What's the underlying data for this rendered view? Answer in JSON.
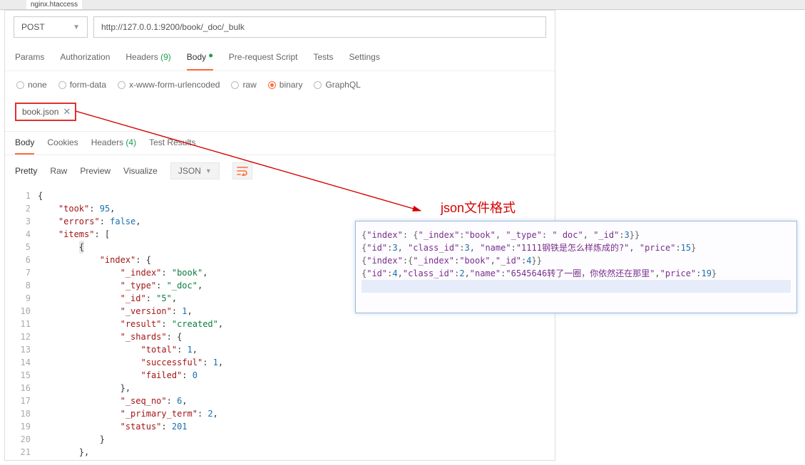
{
  "editor_tab": "nginx.htaccess",
  "request": {
    "method": "POST",
    "url": "http://127.0.0.1:9200/book/_doc/_bulk"
  },
  "req_tabs": {
    "params": "Params",
    "auth": "Authorization",
    "headers_label": "Headers",
    "headers_count": "(9)",
    "body": "Body",
    "prerequest": "Pre-request Script",
    "tests": "Tests",
    "settings": "Settings"
  },
  "body_types": {
    "none": "none",
    "formdata": "form-data",
    "urlencoded": "x-www-form-urlencoded",
    "raw": "raw",
    "binary": "binary",
    "graphql": "GraphQL"
  },
  "file_chip": "book.json",
  "resp_tabs": {
    "body": "Body",
    "cookies": "Cookies",
    "headers_label": "Headers",
    "headers_count": "(4)",
    "test_results": "Test Results"
  },
  "view_modes": {
    "pretty": "Pretty",
    "raw": "Raw",
    "preview": "Preview",
    "visualize": "Visualize",
    "lang": "JSON"
  },
  "code_lines": [
    "{",
    "    \"took\": 95,",
    "    \"errors\": false,",
    "    \"items\": [",
    "        {",
    "            \"index\": {",
    "                \"_index\": \"book\",",
    "                \"_type\": \"_doc\",",
    "                \"_id\": \"5\",",
    "                \"_version\": 1,",
    "                \"result\": \"created\",",
    "                \"_shards\": {",
    "                    \"total\": 1,",
    "                    \"successful\": 1,",
    "                    \"failed\": 0",
    "                },",
    "                \"_seq_no\": 6,",
    "                \"_primary_term\": 2,",
    "                \"status\": 201",
    "            }",
    "        },"
  ],
  "annotation_title": "json文件格式",
  "json_file_lines": [
    "{\"index\": {\"_index\":\"book\", \"_type\": \" doc\", \"_id\":3}}",
    "{\"id\":3, \"class_id\":3, \"name\":\"1111钢铁是怎么样炼成的?\", \"price\":15}",
    "{\"index\":{\"_index\":\"book\",\"_id\":4}}",
    "{\"id\":4,\"class_id\":2,\"name\":\"6545646转了一圈，你依然还在那里\",\"price\":19}"
  ]
}
